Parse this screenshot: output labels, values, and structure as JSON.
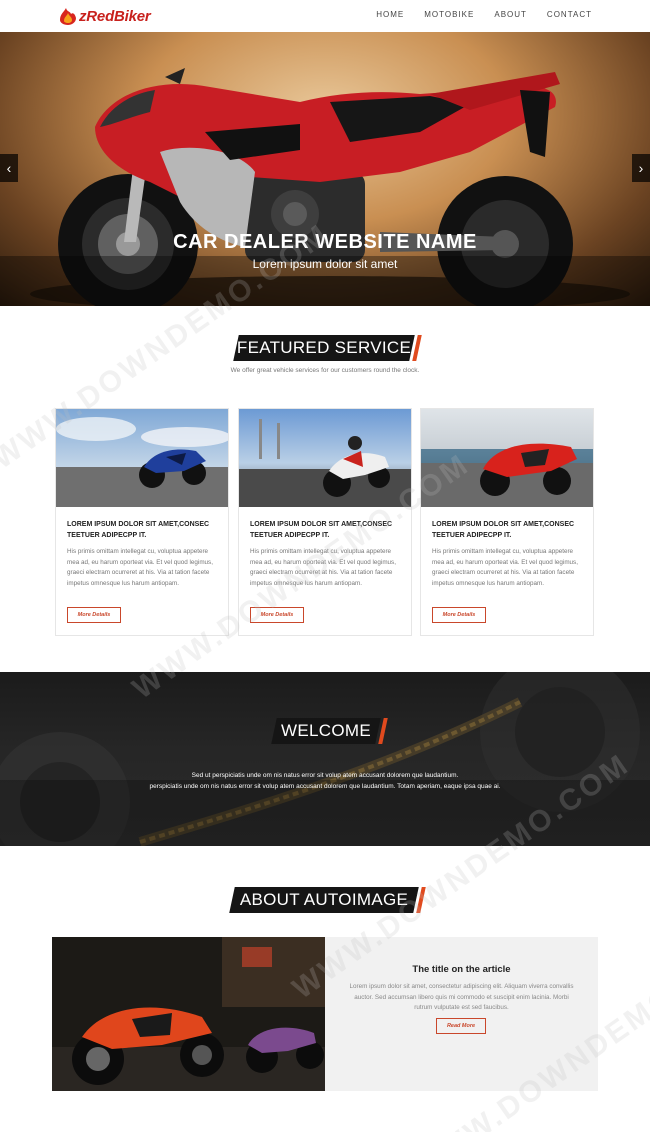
{
  "brand": {
    "logo_text": "zRedBiker"
  },
  "nav": {
    "items": [
      "HOME",
      "MOTOBIKE",
      "ABOUT",
      "CONTACT"
    ]
  },
  "hero": {
    "title": "CAR DEALER WEBSITE NAME",
    "subtitle": "Lorem ipsum dolor sit amet",
    "prev_glyph": "‹",
    "next_glyph": "›"
  },
  "featured": {
    "title": "FEATURED SERVICE",
    "subtitle": "We offer great vehicle services for our customers round the clock.",
    "cards": [
      {
        "title": "LOREM IPSUM DOLOR SIT AMET,CONSEC TEETUER ADIPECPP IT.",
        "body": "His primis omittam intellegat cu, voluptua appetere mea ad, eu harum oporteat via. Et vel quod legimus, graeci electram ocurreret at his. Via at tation facete impetus omnesque lus harum antiopam.",
        "button": "More Details"
      },
      {
        "title": "LOREM IPSUM DOLOR SIT AMET,CONSEC TEETUER ADIPECPP IT.",
        "body": "His primis omittam intellegat cu, voluptua appetere mea ad, eu harum oporteat via. Et vel quod legimus, graeci electram ocurreret at his. Via at tation facete impetus omnesque lus harum antiopam.",
        "button": "More Details"
      },
      {
        "title": "LOREM IPSUM DOLOR SIT AMET,CONSEC TEETUER ADIPECPP IT.",
        "body": "His primis omittam intellegat cu, voluptua appetere mea ad, eu harum oporteat via. Et vel quod legimus, graeci electram ocurreret at his. Via at tation facete impetus omnesque lus harum antiopam.",
        "button": "More Details"
      }
    ]
  },
  "welcome": {
    "title": "WELCOME",
    "line1": "Sed ut perspiciatis unde om nis natus error sit volup atem accusant dolorem que laudantium.",
    "line2": "perspiciatis unde om nis natus error sit volup atem accusant dolorem que laudantium. Totam aperiam, eaque ipsa quae ai."
  },
  "about": {
    "title": "ABOUT AUTOIMAGE",
    "heading": "The title on the article",
    "text": "Lorem ipsum dolor sit amet, consectetur adipiscing elit. Aliquam viverra convallis auctor. Sed accumsan libero quis mi commodo et suscipit enim lacinia. Morbi rutrum vulputate est sed faucibus.",
    "button": "Read More"
  },
  "colors": {
    "brand_red": "#c8211d",
    "accent_orange": "#e04a1e",
    "button_border": "#c9472b",
    "badge_dark": "#151515"
  },
  "watermark": "WWW.DOWNDEMO.COM"
}
